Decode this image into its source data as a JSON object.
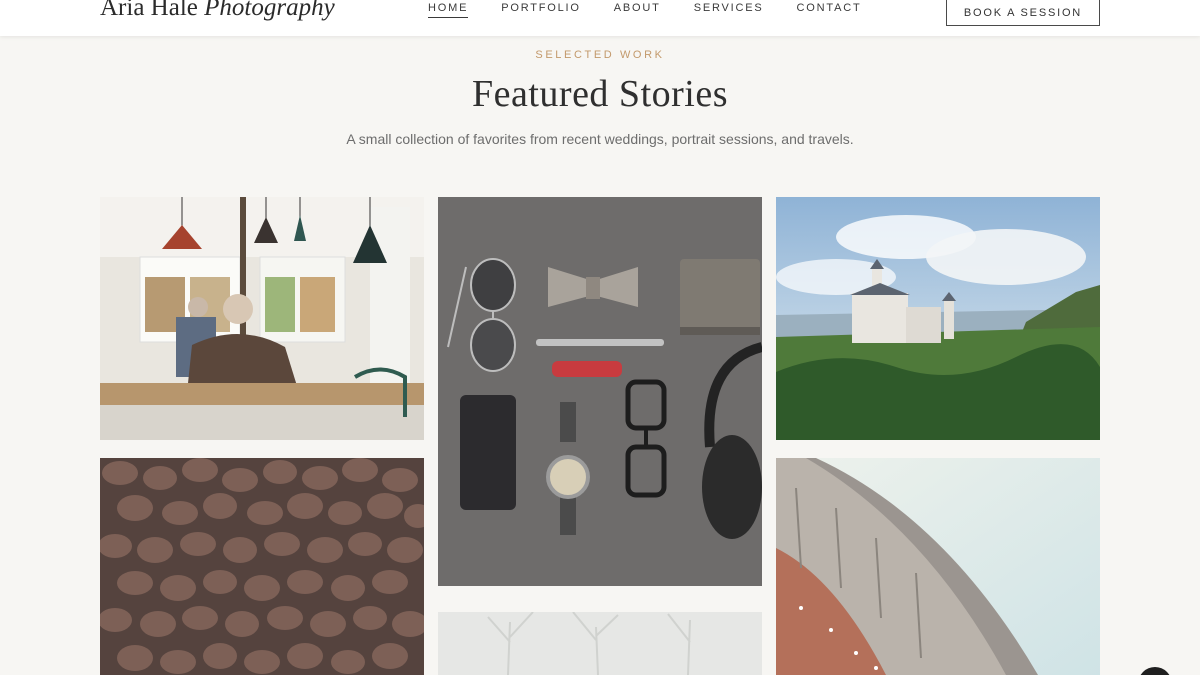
{
  "header": {
    "brand_plain": "Aria Hale",
    "brand_italic": "Photography",
    "nav": [
      {
        "label": "HOME",
        "active": true
      },
      {
        "label": "PORTFOLIO"
      },
      {
        "label": "ABOUT"
      },
      {
        "label": "SERVICES"
      },
      {
        "label": "CONTACT"
      }
    ],
    "cta_label": "BOOK A SESSION"
  },
  "intro": {
    "eyebrow": "SELECTED WORK",
    "title": "Featured Stories",
    "subtitle": "A small collection of favorites from recent weddings, portrait sessions, and travels."
  },
  "gallery": {
    "photos": [
      {
        "subject": "cafe-interior"
      },
      {
        "subject": "flat-lay-accessories"
      },
      {
        "subject": "castle-landscape"
      },
      {
        "subject": "coffee-beans"
      },
      {
        "subject": "architecture-arch"
      },
      {
        "subject": "misty-trees"
      }
    ]
  },
  "colors": {
    "accent": "#c3996b",
    "background": "#f7f6f3",
    "text": "#2a2a2a"
  },
  "icons": {
    "chat": "chat-bubble-icon"
  }
}
